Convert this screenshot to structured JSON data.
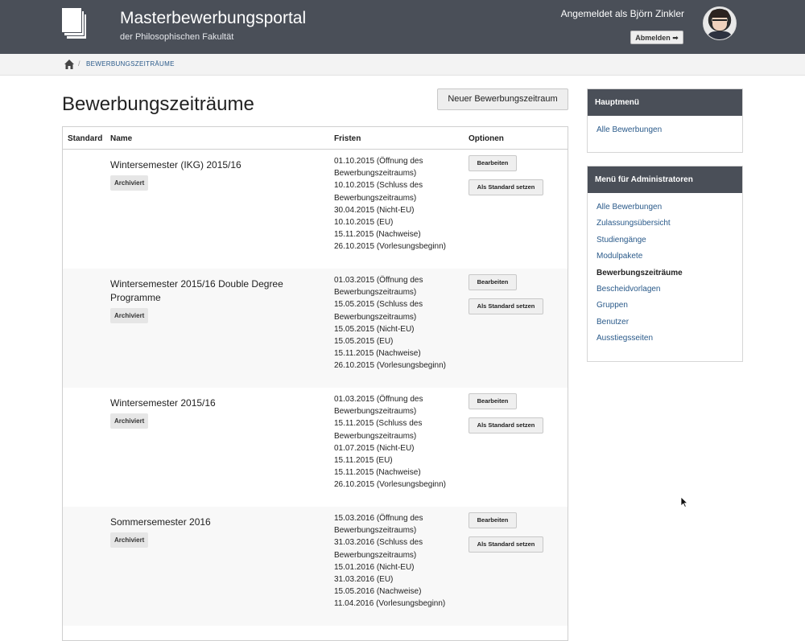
{
  "header": {
    "title": "Masterbewerbungsportal",
    "subtitle": "der Philosophischen Fakultät",
    "login_text": "Angemeldet als Björn Zinkler",
    "logout_label": "Abmelden ➡"
  },
  "breadcrumb": {
    "current": "BEWERBUNGSZEITRÄUME"
  },
  "main": {
    "title": "Bewerbungszeiträume",
    "new_button": "Neuer Bewerbungszeitraum",
    "columns": [
      "Standard",
      "Name",
      "Fristen",
      "Optionen"
    ],
    "rows": [
      {
        "name": "Wintersemester (IKG) 2015/16",
        "badge": "Archiviert",
        "deadlines": [
          "01.10.2015 (Öffnung des",
          "Bewerbungszeitraums)",
          "10.10.2015 (Schluss des",
          "Bewerbungszeitraums)",
          "30.04.2015 (Nicht-EU)",
          "10.10.2015 (EU)",
          "15.11.2015 (Nachweise)",
          "26.10.2015 (Vorlesungsbeginn)"
        ],
        "edit": "Bearbeiten",
        "set_default": "Als Standard setzen"
      },
      {
        "name": "Wintersemester 2015/16 Double Degree Programme",
        "badge": "Archiviert",
        "deadlines": [
          "01.03.2015 (Öffnung des",
          "Bewerbungszeitraums)",
          "15.05.2015 (Schluss des",
          "Bewerbungszeitraums)",
          "15.05.2015 (Nicht-EU)",
          "15.05.2015 (EU)",
          "15.11.2015 (Nachweise)",
          "26.10.2015 (Vorlesungsbeginn)"
        ],
        "edit": "Bearbeiten",
        "set_default": "Als Standard setzen"
      },
      {
        "name": "Wintersemester 2015/16",
        "badge": "Archiviert",
        "deadlines": [
          "01.03.2015 (Öffnung des",
          "Bewerbungszeitraums)",
          "15.11.2015 (Schluss des",
          "Bewerbungszeitraums)",
          "01.07.2015 (Nicht-EU)",
          "15.11.2015 (EU)",
          "15.11.2015 (Nachweise)",
          "26.10.2015 (Vorlesungsbeginn)"
        ],
        "edit": "Bearbeiten",
        "set_default": "Als Standard setzen"
      },
      {
        "name": "Sommersemester 2016",
        "badge": "Archiviert",
        "deadlines": [
          "15.03.2016 (Öffnung des",
          "Bewerbungszeitraums)",
          "31.03.2016 (Schluss des",
          "Bewerbungszeitraums)",
          "15.01.2016 (Nicht-EU)",
          "31.03.2016 (EU)",
          "15.05.2016 (Nachweise)",
          "11.04.2016 (Vorlesungsbeginn)"
        ],
        "edit": "Bearbeiten",
        "set_default": "Als Standard setzen"
      }
    ]
  },
  "sidebar": {
    "main_menu": {
      "title": "Hauptmenü",
      "items": [
        "Alle Bewerbungen"
      ]
    },
    "admin_menu": {
      "title": "Menü für Administratoren",
      "items": [
        "Alle Bewerbungen",
        "Zulassungsübersicht",
        "Studiengänge",
        "Modulpakete",
        "Bewerbungszeiträume",
        "Bescheidvorlagen",
        "Gruppen",
        "Benutzer",
        "Ausstiegsseiten"
      ],
      "active": "Bewerbungszeiträume"
    }
  },
  "colors": {
    "header_bg": "#4a4f58",
    "link": "#2a5a8a",
    "row_alt": "#f8f8f8"
  }
}
